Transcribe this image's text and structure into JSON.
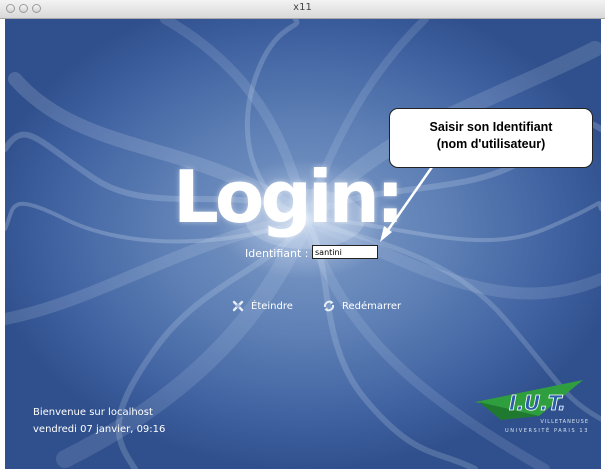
{
  "window": {
    "title": "x11"
  },
  "login": {
    "title": "Login:",
    "identifier_label": "Identifiant :",
    "identifier_value": "santini"
  },
  "actions": {
    "shutdown_label": "Éteindre",
    "restart_label": "Redémarrer"
  },
  "welcome": {
    "line1": "Bienvenue sur localhost",
    "line2": "vendredi 07 janvier, 09:16"
  },
  "logo": {
    "name": "I.U.T.",
    "line1": "VILLETANEUSE",
    "line2": "UNIVERSITÉ PARIS 13"
  },
  "annotation": {
    "line1": "Saisir son Identifiant",
    "line2": "(nom d'utilisateur)"
  },
  "colors": {
    "background_blue": "#4a6ea8",
    "logo_green": "#2f9e3f",
    "logo_blue": "#2b5ea7"
  }
}
